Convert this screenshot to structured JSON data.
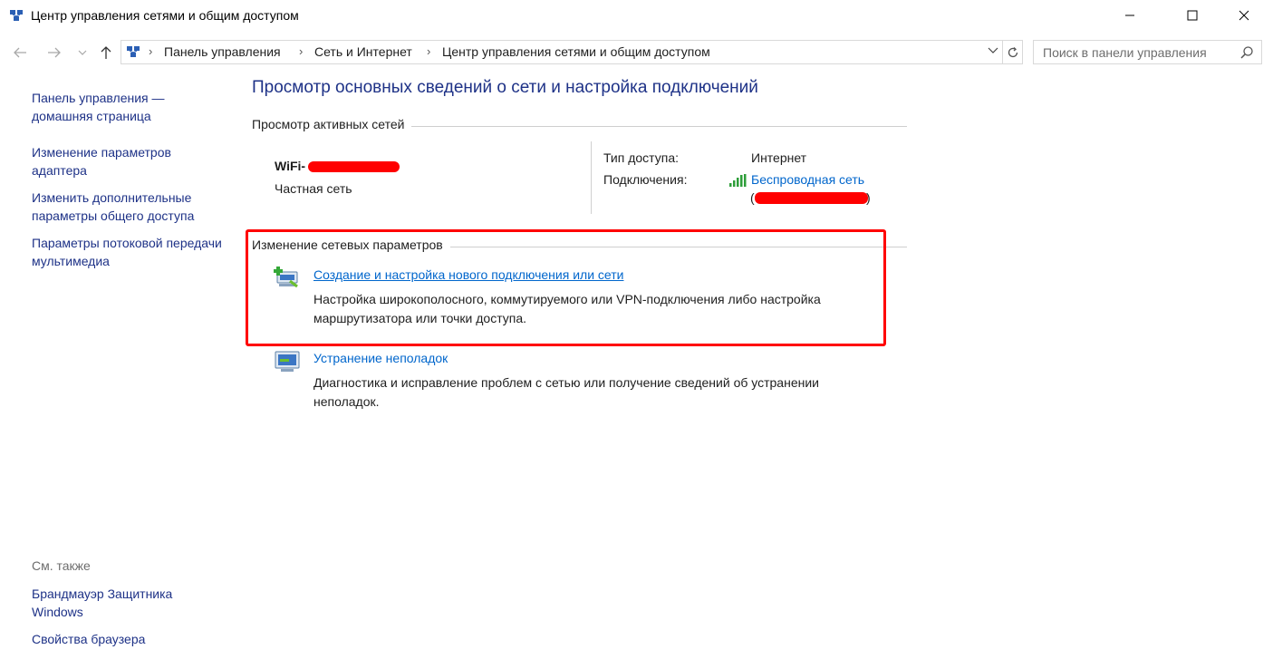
{
  "window": {
    "title": "Центр управления сетями и общим доступом"
  },
  "address": {
    "crumbs": [
      "Панель управления",
      "Сеть и Интернет",
      "Центр управления сетями и общим доступом"
    ]
  },
  "search": {
    "placeholder": "Поиск в панели управления"
  },
  "left_pane": {
    "home_link": "Панель управления — домашняя страница",
    "links": [
      "Изменение параметров адаптера",
      "Изменить дополнительные параметры общего доступа",
      "Параметры потоковой передачи мультимедиа"
    ],
    "see_also_title": "См. также",
    "see_also": [
      "Брандмауэр Защитника Windows",
      "Свойства браузера"
    ]
  },
  "main": {
    "title": "Просмотр основных сведений о сети и настройка подключений",
    "active_networks_header": "Просмотр активных сетей",
    "network": {
      "name": "WiFi-",
      "type": "Частная сеть",
      "access_label": "Тип доступа:",
      "access_value": "Интернет",
      "connections_label": "Подключения:",
      "connection_link": "Беспроводная сеть",
      "connection_paren_open": "(",
      "connection_paren_close": ")"
    },
    "change_settings_header": "Изменение сетевых параметров",
    "tasks": [
      {
        "link": "Создание и настройка нового подключения или сети",
        "description": "Настройка широкополосного, коммутируемого или VPN-подключения либо настройка маршрутизатора или точки доступа."
      },
      {
        "link": "Устранение неполадок",
        "description": "Диагностика и исправление проблем с сетью или получение сведений об устранении неполадок."
      }
    ]
  },
  "colors": {
    "link": "#1e3287",
    "link_bright": "#0066cc",
    "highlight": "#ff0000"
  },
  "icons": [
    "network-center-icon",
    "back-arrow-icon",
    "forward-arrow-icon",
    "up-arrow-icon",
    "refresh-icon",
    "search-icon",
    "signal-bars-icon",
    "new-connection-icon",
    "troubleshoot-icon"
  ]
}
